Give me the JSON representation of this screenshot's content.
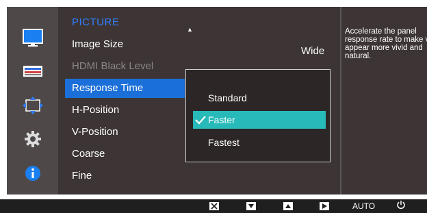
{
  "menu": {
    "title": "PICTURE",
    "items": [
      {
        "label": "Image Size"
      },
      {
        "label": "HDMI Black Level"
      },
      {
        "label": "Response Time"
      },
      {
        "label": "H-Position"
      },
      {
        "label": "V-Position"
      },
      {
        "label": "Coarse"
      },
      {
        "label": "Fine"
      }
    ],
    "image_size_value": "Wide",
    "selected_index": 2
  },
  "dropdown": {
    "options": [
      {
        "label": "Standard"
      },
      {
        "label": "Faster"
      },
      {
        "label": "Fastest"
      }
    ],
    "selected": "Faster"
  },
  "help": {
    "text": "Accelerate the panel response rate to make video appear more vivid and natural."
  },
  "icons": [
    "monitor-icon",
    "menu-lines-icon",
    "resize-arrows-icon",
    "gear-icon",
    "info-icon"
  ],
  "bottom_bar": {
    "buttons": [
      "close-key-icon",
      "down-key-icon",
      "up-key-icon",
      "enter-key-icon"
    ],
    "auto_label": "AUTO",
    "power_icon": "power-icon"
  },
  "colors": {
    "accent_blue": "#1a6fd8",
    "title_blue": "#2f7fff",
    "selected_option": "#27bab8",
    "panel_bg": "#3d3535"
  }
}
